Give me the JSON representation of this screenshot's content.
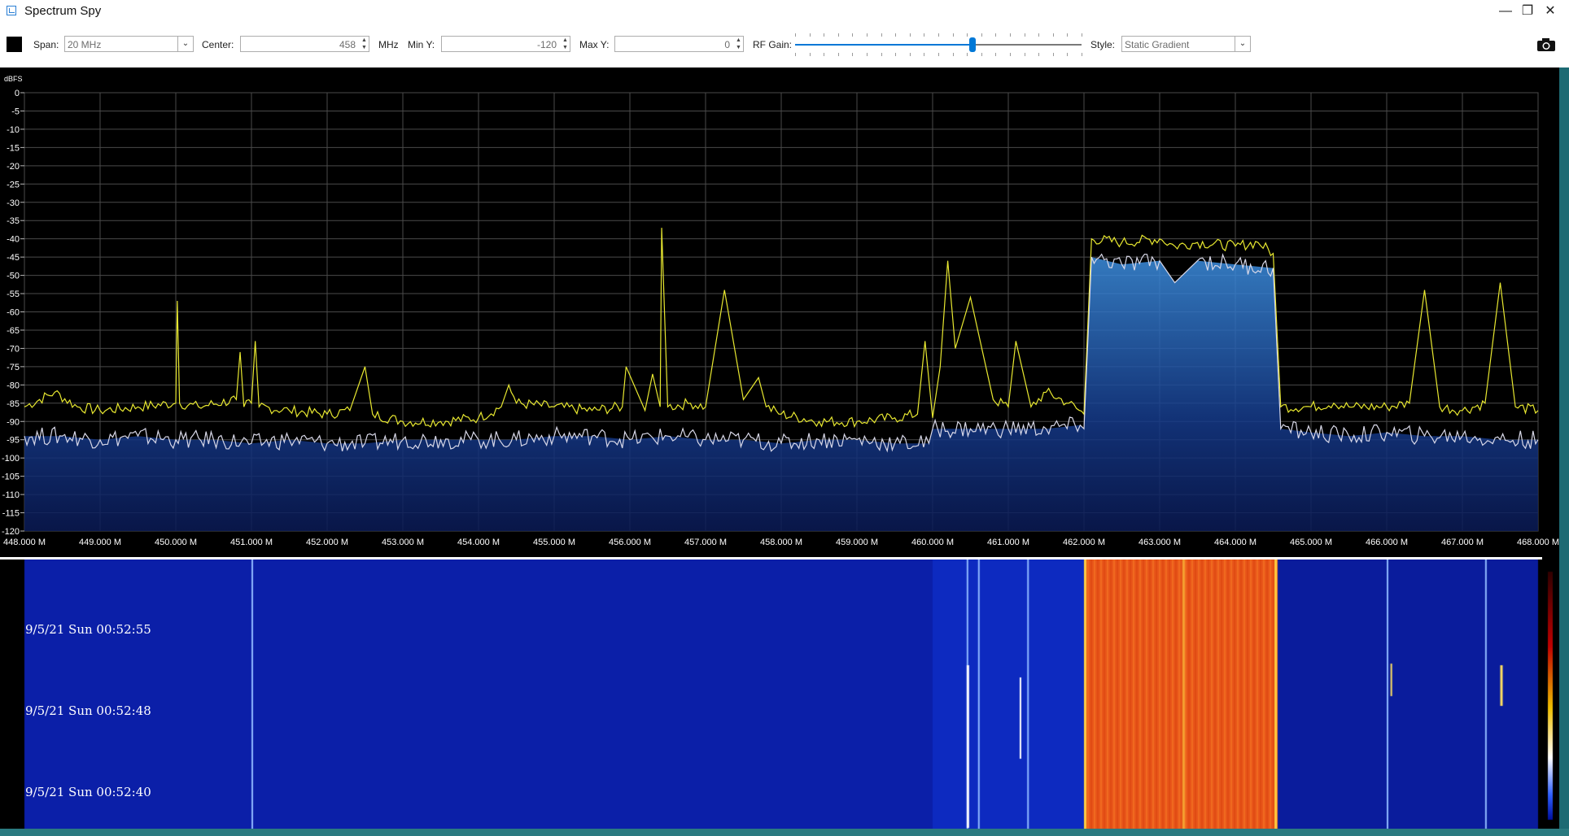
{
  "window": {
    "title": "Spectrum Spy",
    "minimize": "—",
    "restore": "❐",
    "close": "✕"
  },
  "toolbar": {
    "span_label": "Span:",
    "span_value": "20 MHz",
    "center_label": "Center:",
    "center_value": "458",
    "center_unit": "MHz",
    "miny_label": "Min Y:",
    "miny_value": "-120",
    "maxy_label": "Max Y:",
    "maxy_value": "0",
    "rfgain_label": "RF Gain:",
    "rfgain_level": 0.62,
    "style_label": "Style:",
    "style_value": "Static Gradient",
    "icons": {
      "color": "color-swatch-icon",
      "camera": "camera-icon"
    }
  },
  "chart_data": {
    "type": "line",
    "ylabel": "dBFS",
    "xlim": [
      448.0,
      468.0
    ],
    "ylim": [
      -120,
      0
    ],
    "grid": true,
    "x_ticks": [
      "448.000 M",
      "449.000 M",
      "450.000 M",
      "451.000 M",
      "452.000 M",
      "453.000 M",
      "454.000 M",
      "455.000 M",
      "456.000 M",
      "457.000 M",
      "458.000 M",
      "459.000 M",
      "460.000 M",
      "461.000 M",
      "462.000 M",
      "463.000 M",
      "464.000 M",
      "465.000 M",
      "466.000 M",
      "467.000 M",
      "468.000 M"
    ],
    "y_ticks": [
      "0",
      "-5",
      "-10",
      "-15",
      "-20",
      "-25",
      "-30",
      "-35",
      "-40",
      "-45",
      "-50",
      "-55",
      "-60",
      "-65",
      "-70",
      "-75",
      "-80",
      "-85",
      "-90",
      "-95",
      "-100",
      "-105",
      "-110",
      "-115",
      "-120"
    ],
    "series": [
      {
        "color": "#e8e830",
        "x": [
          448.0,
          448.4,
          448.7,
          449.0,
          449.5,
          450.0,
          450.02,
          450.05,
          450.3,
          450.8,
          450.85,
          450.9,
          451.0,
          451.05,
          451.1,
          451.5,
          452.0,
          452.3,
          452.5,
          452.6,
          453.0,
          453.5,
          454.0,
          454.3,
          454.4,
          454.5,
          455.0,
          455.5,
          455.9,
          455.95,
          456.2,
          456.3,
          456.4,
          456.42,
          456.5,
          456.8,
          457.0,
          457.25,
          457.5,
          457.7,
          457.8,
          458.0,
          458.5,
          459.0,
          459.5,
          459.8,
          459.9,
          460.0,
          460.1,
          460.2,
          460.3,
          460.5,
          460.8,
          461.0,
          461.1,
          461.3,
          461.5,
          461.8,
          462.0,
          462.1,
          462.5,
          463.0,
          463.2,
          463.5,
          464.0,
          464.3,
          464.5,
          464.6,
          465.0,
          465.3,
          465.5,
          466.0,
          466.3,
          466.5,
          466.7,
          467.0,
          467.3,
          467.5,
          467.7,
          468.0
        ],
        "values": [
          -86,
          -82,
          -86,
          -87,
          -86,
          -85,
          -57,
          -85,
          -86,
          -84,
          -71,
          -86,
          -85,
          -68,
          -86,
          -87,
          -88,
          -87,
          -75,
          -88,
          -90,
          -90,
          -89,
          -86,
          -80,
          -85,
          -86,
          -87,
          -86,
          -75,
          -87,
          -77,
          -86,
          -37,
          -86,
          -85,
          -86,
          -54,
          -84,
          -78,
          -86,
          -88,
          -90,
          -90,
          -89,
          -88,
          -68,
          -89,
          -75,
          -46,
          -70,
          -56,
          -84,
          -86,
          -68,
          -86,
          -82,
          -85,
          -88,
          -40,
          -41,
          -40,
          -42,
          -41,
          -42,
          -41,
          -44,
          -86,
          -86,
          -85,
          -86,
          -86,
          -85,
          -54,
          -86,
          -87,
          -85,
          -52,
          -86,
          -87
        ]
      },
      {
        "color": "#d8d8e8",
        "x": [
          448.0,
          448.5,
          449.0,
          449.5,
          450.0,
          450.5,
          451.0,
          451.5,
          452.0,
          452.5,
          453.0,
          453.5,
          454.0,
          454.5,
          455.0,
          455.5,
          456.0,
          456.5,
          457.0,
          457.5,
          458.0,
          458.5,
          459.0,
          459.5,
          459.95,
          460.0,
          460.5,
          461.0,
          461.5,
          461.95,
          462.0,
          462.1,
          462.5,
          463.0,
          463.2,
          463.5,
          464.0,
          464.5,
          464.6,
          465.0,
          465.5,
          466.0,
          466.5,
          467.0,
          467.5,
          468.0
        ],
        "values": [
          -94,
          -94,
          -95,
          -94,
          -95,
          -95,
          -96,
          -95,
          -96,
          -96,
          -95,
          -95,
          -95,
          -95,
          -94,
          -94,
          -95,
          -94,
          -95,
          -95,
          -96,
          -95,
          -95,
          -96,
          -96,
          -92,
          -92,
          -92,
          -92,
          -91,
          -92,
          -45,
          -47,
          -46,
          -52,
          -46,
          -47,
          -48,
          -92,
          -93,
          -94,
          -93,
          -94,
          -94,
          -95,
          -95
        ]
      }
    ]
  },
  "waterfall": {
    "timestamps": [
      "9/5/21 Sun 00:52:55",
      "9/5/21 Sun 00:52:48",
      "9/5/21 Sun 00:52:40"
    ]
  }
}
